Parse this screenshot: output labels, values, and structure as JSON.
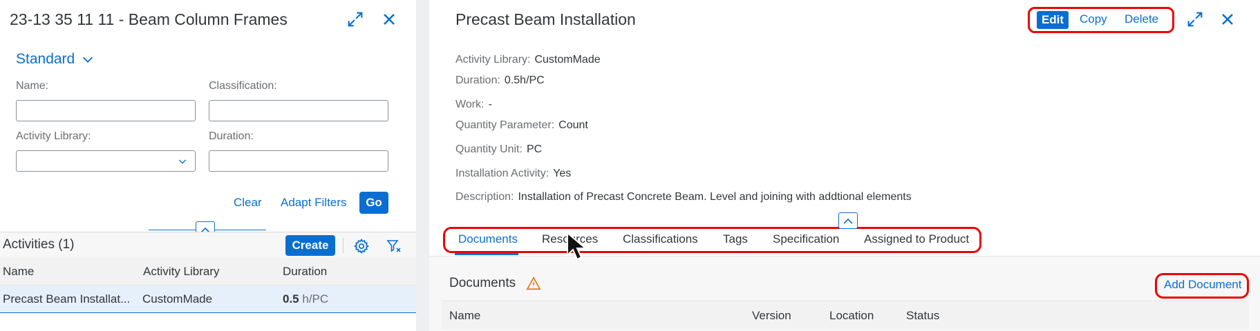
{
  "left": {
    "title": "23-13 35 11 11 - Beam Column Frames",
    "icons": {
      "expand": "expand-icon",
      "close": "close-icon"
    },
    "variant": "Standard",
    "filters": {
      "name_label": "Name:",
      "classification_label": "Classification:",
      "activity_library_label": "Activity Library:",
      "duration_label": "Duration:"
    },
    "actions": {
      "clear": "Clear",
      "adapt": "Adapt Filters",
      "go": "Go"
    },
    "toolbar": {
      "title": "Activities (1)",
      "create": "Create"
    },
    "table": {
      "headers": [
        "Name",
        "Activity Library",
        "Duration"
      ],
      "rows": [
        {
          "name": "Precast Beam Installat...",
          "library": "CustomMade",
          "duration_value": "0.5",
          "duration_unit": "h/PC"
        }
      ]
    }
  },
  "right": {
    "title": "Precast Beam Installation",
    "actions": {
      "edit": "Edit",
      "copy": "Copy",
      "delete": "Delete"
    },
    "attributes": [
      {
        "label": "Activity Library:",
        "value": "CustomMade"
      },
      {
        "label": "Duration:",
        "value": "0.5h/PC"
      },
      {
        "label": "Work:",
        "value": "-"
      },
      {
        "label": "Quantity Parameter:",
        "value": "Count"
      },
      {
        "label": "Quantity Unit:",
        "value": "PC"
      },
      {
        "label": "Installation Activity:",
        "value": "Yes"
      },
      {
        "label": "Description:",
        "value": "Installation of Precast Concrete Beam. Level and joining with addtional elements"
      }
    ],
    "tabs": [
      "Documents",
      "Resources",
      "Classifications",
      "Tags",
      "Specification",
      "Assigned to Product"
    ],
    "active_tab": "Documents",
    "documents": {
      "title": "Documents",
      "add_label": "Add Document",
      "headers": [
        "Name",
        "Version",
        "Location",
        "Status"
      ]
    }
  },
  "colors": {
    "accent": "#0a6ed1",
    "highlight": "#e00000",
    "warning": "#e9730c"
  }
}
